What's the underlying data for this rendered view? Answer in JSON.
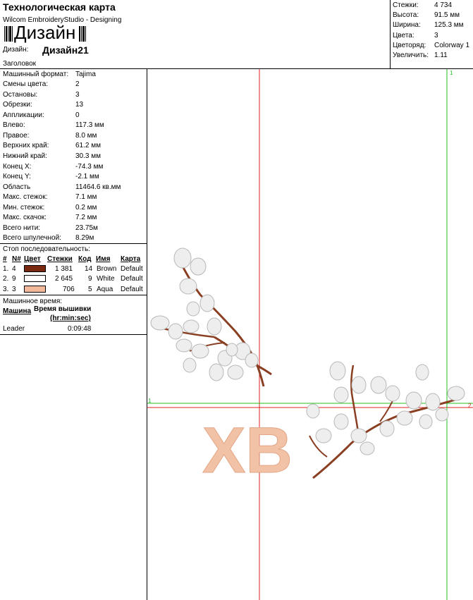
{
  "header": {
    "title": "Технологическая карта",
    "software": "Wilcom EmbroideryStudio - Designing",
    "design_big": "Дизайн",
    "design_label": "Дизайн:",
    "design_name": "Дизайн21",
    "heading_label": "Заголовок"
  },
  "summary": [
    {
      "label": "Стежки:",
      "value": "4 734"
    },
    {
      "label": "Высота:",
      "value": "91.5 мм"
    },
    {
      "label": "Ширина:",
      "value": "125.3 мм"
    },
    {
      "label": "Цвета:",
      "value": "3"
    },
    {
      "label": "Цветоряд:",
      "value": "Colorway 1"
    },
    {
      "label": "Увеличить:",
      "value": "1.11"
    }
  ],
  "details": [
    {
      "label": "Машинный формат:",
      "value": "Tajima"
    },
    {
      "label": "Смены цвета:",
      "value": "2"
    },
    {
      "label": "Остановы:",
      "value": "3"
    },
    {
      "label": "Обрезки:",
      "value": "13"
    },
    {
      "label": "Аппликации:",
      "value": "0"
    },
    {
      "label": "Влево:",
      "value": "117.3 мм"
    },
    {
      "label": "Правое:",
      "value": "8.0 мм"
    },
    {
      "label": "Верхних край:",
      "value": "61.2 мм"
    },
    {
      "label": "Нижний край:",
      "value": "30.3 мм"
    },
    {
      "label": "Конец X:",
      "value": "-74.3 мм"
    },
    {
      "label": "Конец Y:",
      "value": "-2.1 мм"
    },
    {
      "label": "Область",
      "value": "11464.6 кв.мм"
    },
    {
      "label": "Макс. стежок:",
      "value": "7.1 мм"
    },
    {
      "label": "Мин. стежок:",
      "value": "0.2 мм"
    },
    {
      "label": "Макс. скачок:",
      "value": "7.2 мм"
    },
    {
      "label": "Всего нити:",
      "value": "23.75м"
    },
    {
      "label": "Всего шпулечной:",
      "value": "8.29м"
    }
  ],
  "sequence": {
    "title": "Стоп последовательность:",
    "columns": [
      "#",
      "N#",
      "Цвет",
      "Стежки",
      "Код",
      "Имя",
      "Карта"
    ],
    "rows": [
      {
        "num": "1.",
        "n": "4",
        "color": "#7a2a10",
        "stitches": "1 381",
        "code": "14",
        "name": "Brown",
        "chart": "Default"
      },
      {
        "num": "2.",
        "n": "9",
        "color": "#ffffff",
        "stitches": "2 645",
        "code": "9",
        "name": "White",
        "chart": "Default"
      },
      {
        "num": "3.",
        "n": "3",
        "color": "#f4b89a",
        "stitches": "706",
        "code": "5",
        "name": "Aqua",
        "chart": "Default"
      }
    ]
  },
  "machine_time": {
    "title": "Машинное время:",
    "col_machine": "Машина",
    "col_time": "Время вышивки",
    "col_time_unit": "(hr:min:sec)",
    "rows": [
      {
        "machine": "Leader",
        "time": "0:09:48"
      }
    ]
  },
  "preview": {
    "text": "ХВ",
    "text_color": "#f2c2a6",
    "branch_color": "#8a3f22",
    "bud_color": "#eeeeee",
    "guide_red": "#e02020",
    "guide_green": "#20c020",
    "marker_1": "1",
    "marker_2": "2"
  }
}
